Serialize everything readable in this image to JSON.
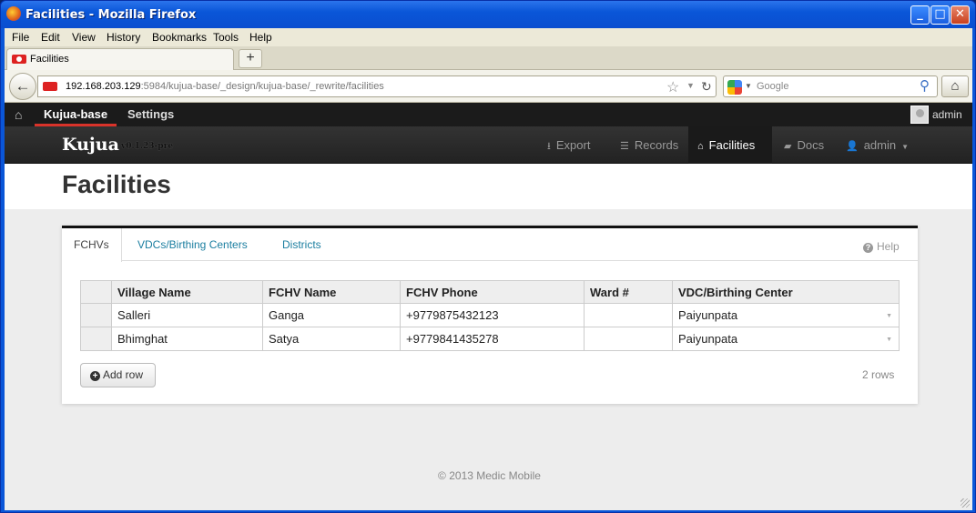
{
  "window": {
    "title": "Facilities - Mozilla Firefox",
    "min": "_",
    "max": "□",
    "close": "✕"
  },
  "menu": [
    "File",
    "Edit",
    "View",
    "History",
    "Bookmarks",
    "Tools",
    "Help"
  ],
  "browser_tab": {
    "label": "Facilities",
    "new_tab": "+"
  },
  "nav": {
    "back": "←",
    "url_host": "192.168.203.129",
    "url_path": ":5984/kujua-base/_design/kujua-base/_rewrite/facilities",
    "search_placeholder": "Google",
    "home": "⌂"
  },
  "topbar": {
    "base": "Kujua-base",
    "settings": "Settings",
    "user": "admin"
  },
  "appbar": {
    "brand": "Kujua",
    "version": "v0.1.23-pre",
    "items": [
      {
        "label": "Export",
        "icon": "⭳"
      },
      {
        "label": "Records",
        "icon": "☰"
      },
      {
        "label": "Facilities",
        "icon": "⌂",
        "active": true
      },
      {
        "label": "Docs",
        "icon": "▰"
      },
      {
        "label": "admin",
        "icon": "👤"
      }
    ]
  },
  "page": {
    "title": "Facilities"
  },
  "panel": {
    "tabs": [
      "FCHVs",
      "VDCs/Birthing Centers",
      "Districts"
    ],
    "help": "Help",
    "columns": [
      "Village Name",
      "FCHV Name",
      "FCHV Phone",
      "Ward #",
      "VDC/Birthing Center"
    ],
    "rows": [
      [
        "Salleri",
        "Ganga",
        "+9779875432123",
        "",
        "Paiyunpata"
      ],
      [
        "Bhimghat",
        "Satya",
        "+9779841435278",
        "",
        "Paiyunpata"
      ]
    ],
    "add_row": "Add row",
    "row_count": "2 rows"
  },
  "footer": "© 2013 Medic Mobile"
}
